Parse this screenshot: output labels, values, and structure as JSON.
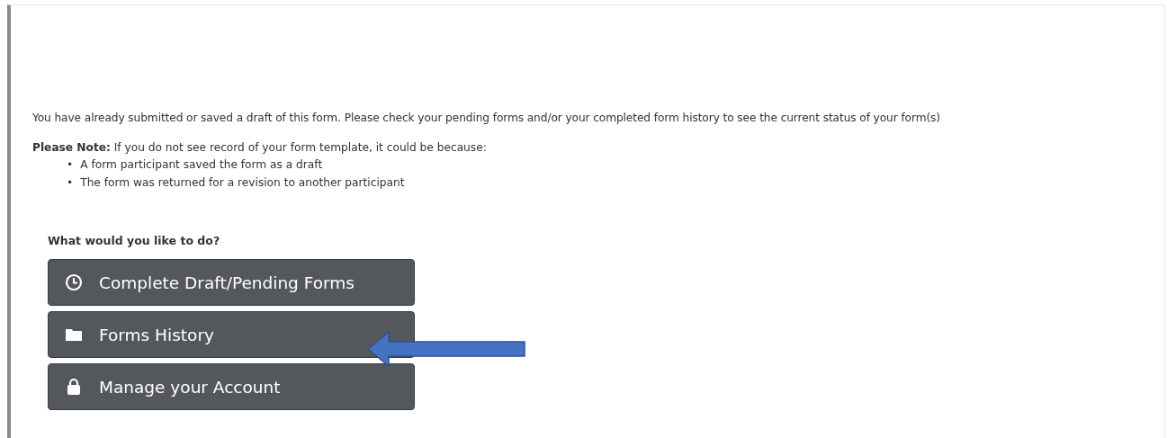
{
  "message": "You have already submitted or saved a draft of this form. Please check your pending forms and/or your completed form history to see the current status of your form(s)",
  "note": {
    "text": "**Please Note:** If you do not see record of your form template, it could be because:",
    "reasons": [
      {
        "bullet": "•",
        "text": "A form participant saved the form as a draft"
      },
      {
        "bullet": "•",
        "text": "The form was returned for a revision to another participant"
      }
    ]
  },
  "prompt": "What would you like to do?",
  "actions": [
    {
      "label": "Complete Draft/Pending Forms",
      "kind": "clock"
    },
    {
      "label": "Forms History",
      "kind": "folder"
    },
    {
      "label": "Manage your Account",
      "kind": "lock"
    }
  ],
  "annotation": {
    "kind": "arrow"
  }
}
